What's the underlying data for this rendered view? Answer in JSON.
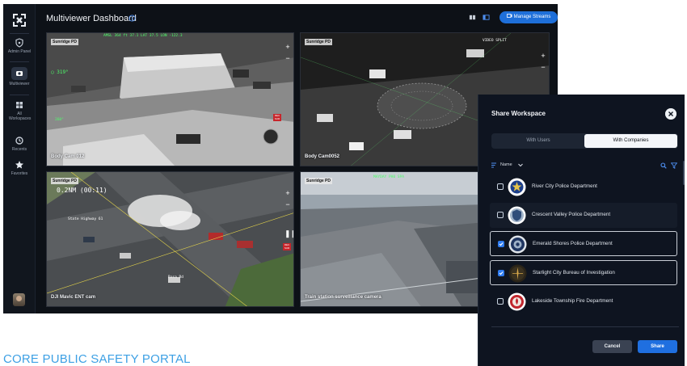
{
  "app": {
    "title": "Multiviewer Dashboard",
    "manage_streams_label": "Manage Streams"
  },
  "rail": {
    "items": [
      {
        "label": "Admin Panel",
        "icon": "shield-icon"
      },
      {
        "label": "Multiviewer",
        "icon": "camera-icon"
      },
      {
        "label": "All Workspaces",
        "icon": "grid-icon"
      },
      {
        "label": "Recents",
        "icon": "clock-icon"
      },
      {
        "label": "Favorites",
        "icon": "star-icon"
      }
    ]
  },
  "tiles": [
    {
      "source": "Sunridge PD",
      "camera": "Body Cam 012",
      "mode": "thermal-white"
    },
    {
      "source": "Sunridge PD",
      "camera": "Body Cam0052",
      "mode": "thermal-night"
    },
    {
      "source": "Sunridge PD",
      "camera": "DJI Mavic ENT cam",
      "mode": "aerial-color",
      "distance": "0.2NM (00:11)",
      "street_1": "State Highway 61",
      "street_2": "Rosa Rd"
    },
    {
      "source": "Sunridge PD",
      "camera": "Train station surveillance camera",
      "mode": "city-day"
    }
  ],
  "share": {
    "title": "Share Workspace",
    "tab_users": "With Users",
    "tab_companies": "With Companies",
    "sort_label": "Name",
    "items": [
      {
        "name": "River City Police Department",
        "checked": false
      },
      {
        "name": "Crescent Valley Police Department",
        "checked": false
      },
      {
        "name": "Emerald Shores Police Department",
        "checked": true
      },
      {
        "name": "Starlight City Bureau of Investigation",
        "checked": true
      },
      {
        "name": "Lakeside Township Fire Department",
        "checked": false
      }
    ],
    "cancel_label": "Cancel",
    "share_label": "Share"
  },
  "footer": {
    "portal_title": "CORE PUBLIC SAFETY PORTAL"
  },
  "colors": {
    "accent": "#1e6fd9",
    "portal_text": "#3da0e4",
    "hud_green": "#4dff6a"
  }
}
